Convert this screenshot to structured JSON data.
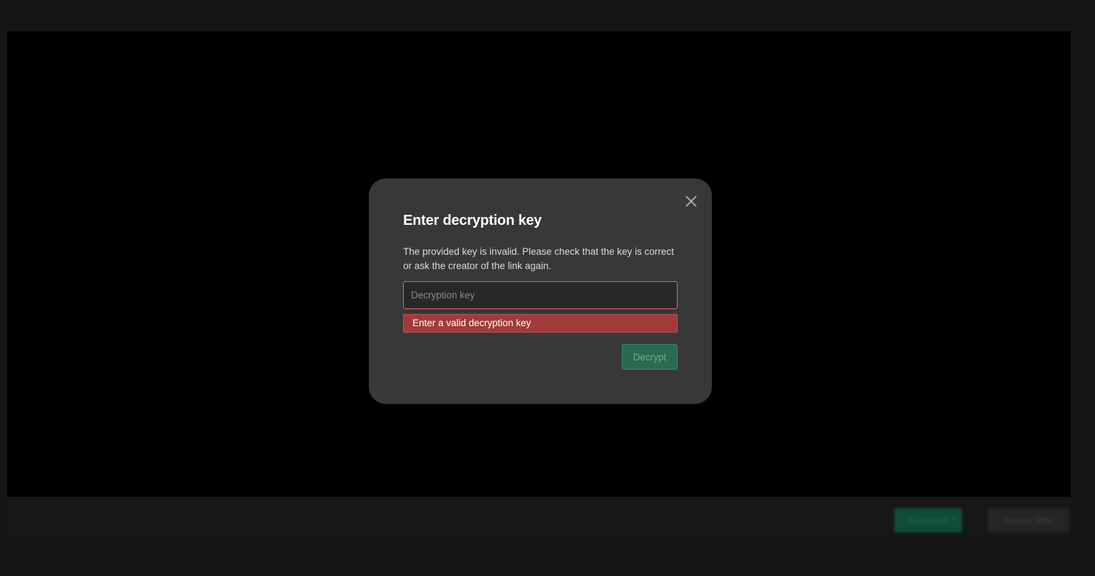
{
  "background": {
    "download_label": "Download",
    "save_label": "Save to Mine"
  },
  "modal": {
    "title": "Enter decryption key",
    "description": "The provided key is invalid. Please check that the key is correct or ask the creator of the link again.",
    "input": {
      "value": "",
      "placeholder": "Decryption key"
    },
    "error": "Enter a valid decryption key",
    "decrypt_label": "Decrypt",
    "close_icon": "close-icon"
  },
  "colors": {
    "modal_bg": "#383838",
    "error_bg": "#a23a3a",
    "error_border": "#e06a6a",
    "accent_green": "#2a6a51"
  }
}
